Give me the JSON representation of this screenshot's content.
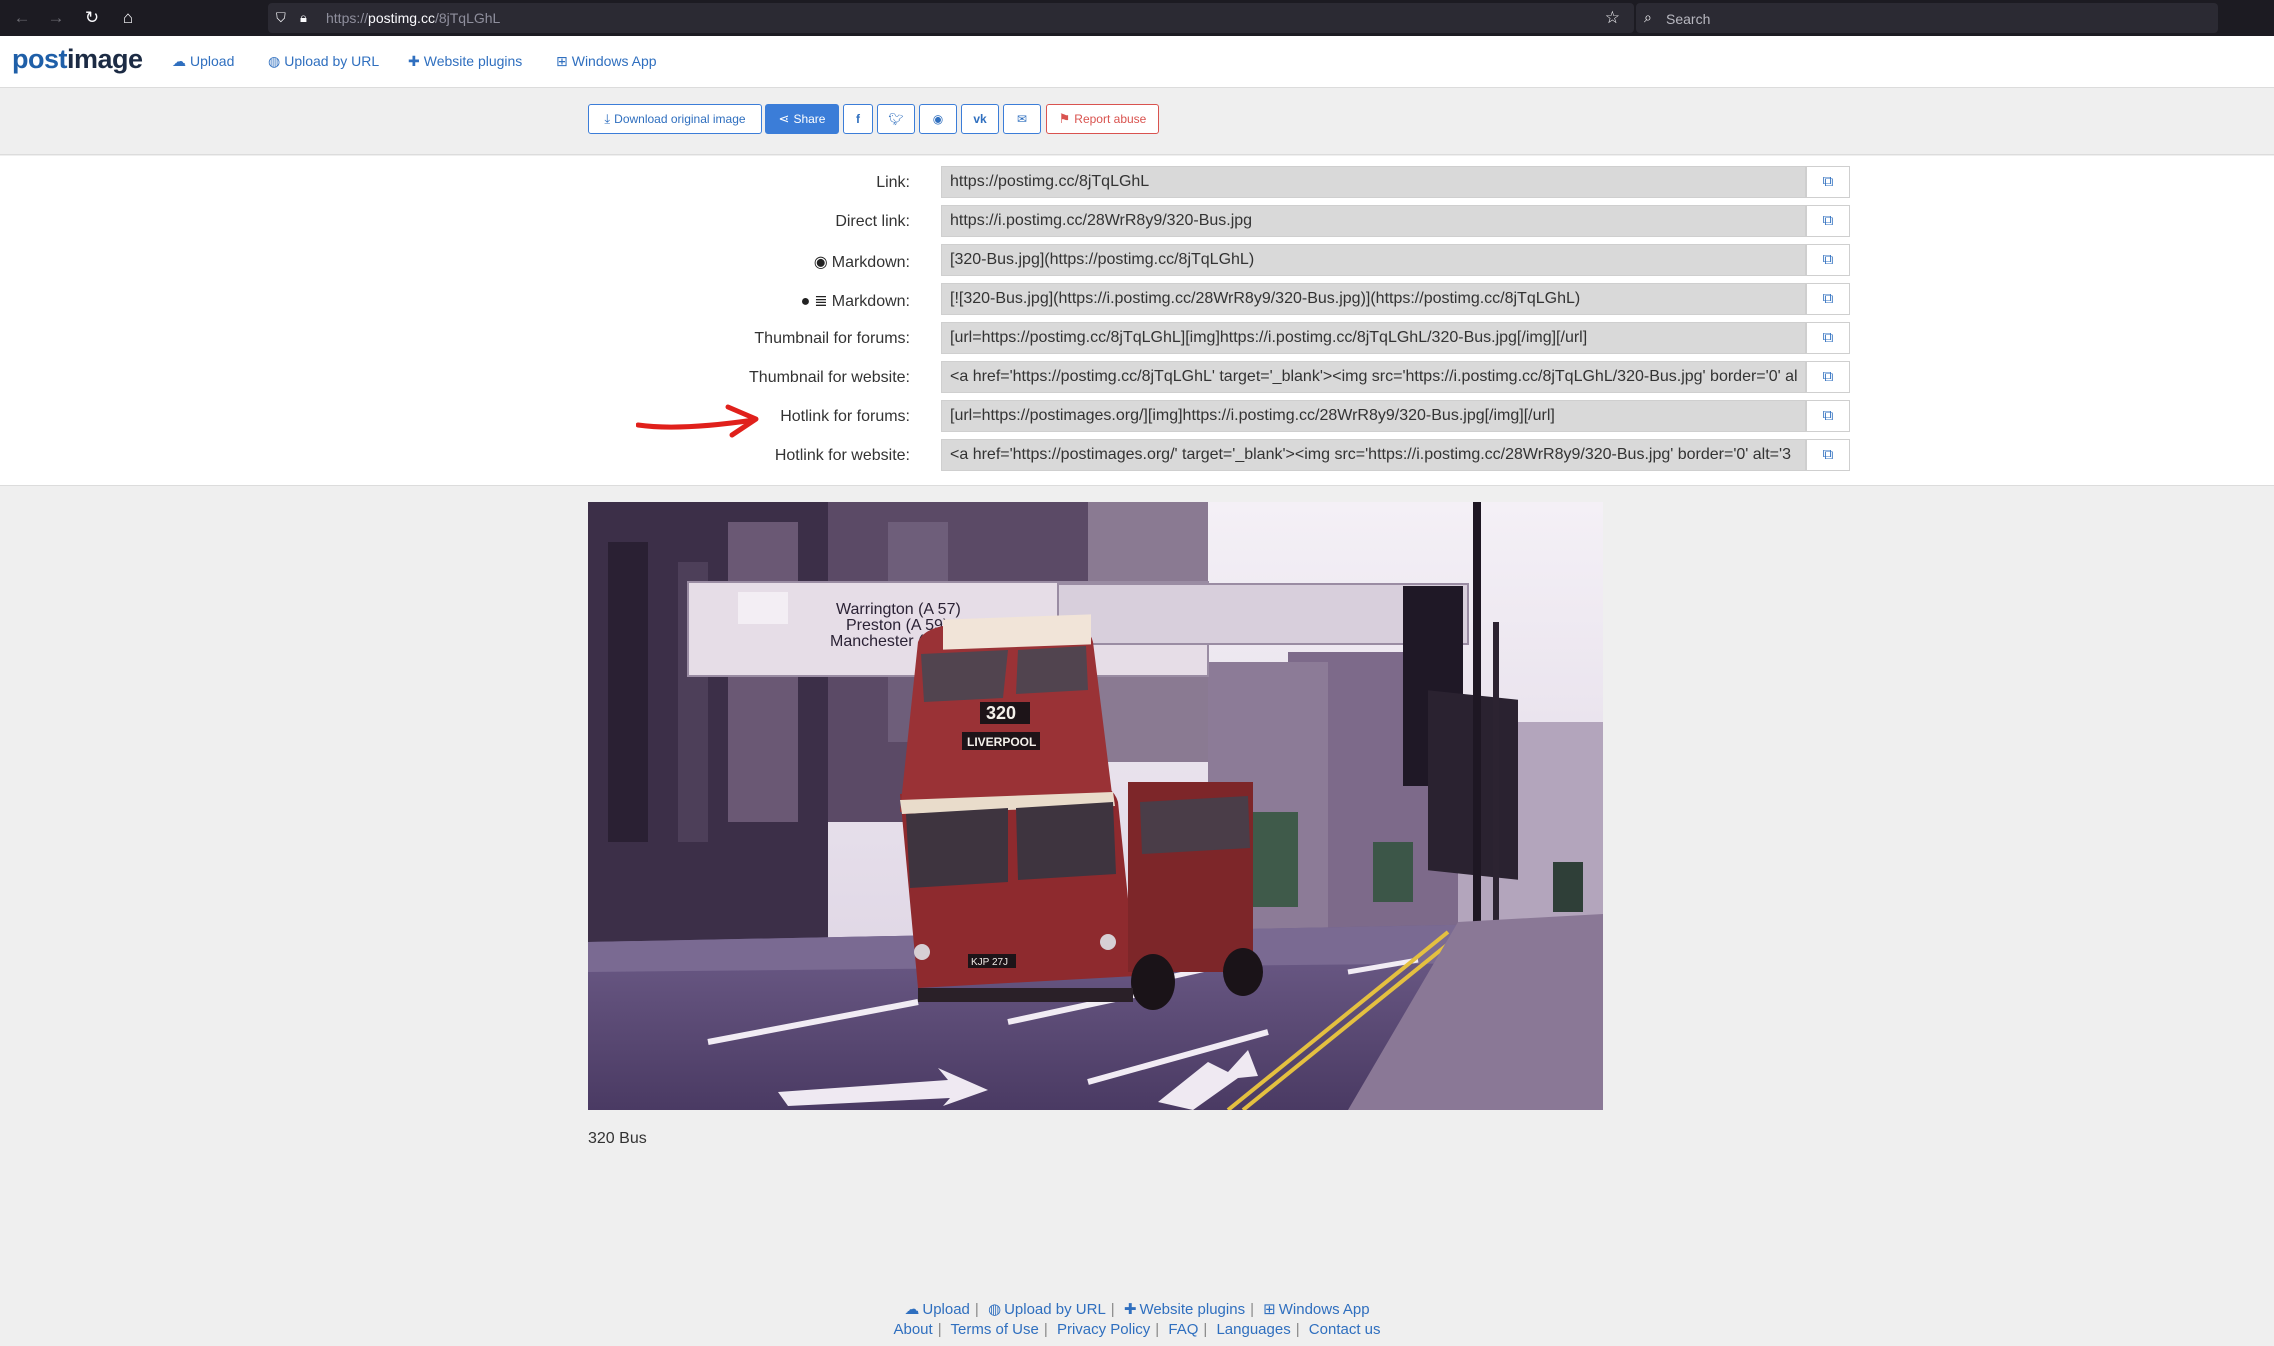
{
  "browser": {
    "back_icon": "arrow-left-icon",
    "forward_icon": "arrow-right-icon",
    "reload_icon": "reload-icon",
    "home_icon": "home-icon",
    "url_scheme": "https://",
    "url_host": "postimg.cc",
    "url_path": "/8jTqLGhL",
    "search_placeholder": "Search"
  },
  "header": {
    "logo_part1": "post",
    "logo_part2": "image",
    "menu": [
      {
        "label": "Upload",
        "icon": "cloud-upload-icon"
      },
      {
        "label": "Upload by URL",
        "icon": "globe-icon"
      },
      {
        "label": "Website plugins",
        "icon": "puzzle-icon"
      },
      {
        "label": "Windows App",
        "icon": "windows-icon"
      }
    ]
  },
  "toolbar": {
    "download_label": "Download original image",
    "share_label": "Share",
    "report_label": "Report abuse",
    "social": [
      "facebook-icon",
      "twitter-icon",
      "reddit-icon",
      "vk-icon",
      "email-icon"
    ]
  },
  "links": [
    {
      "label": "Link:",
      "value": "https://postimg.cc/8jTqLGhL"
    },
    {
      "label": "Direct link:",
      "value": "https://i.postimg.cc/28WrR8y9/320-Bus.jpg"
    },
    {
      "label": "Markdown:",
      "value": "[320-Bus.jpg](https://postimg.cc/8jTqLGhL)",
      "icons": [
        "reddit-icon"
      ]
    },
    {
      "label": "Markdown:",
      "value": "[![320-Bus.jpg](https://i.postimg.cc/28WrR8y9/320-Bus.jpg)](https://postimg.cc/8jTqLGhL)",
      "icons": [
        "github-icon",
        "stackoverflow-icon"
      ]
    },
    {
      "label": "Thumbnail for forums:",
      "value": "[url=https://postimg.cc/8jTqLGhL][img]https://i.postimg.cc/8jTqLGhL/320-Bus.jpg[/img][/url]"
    },
    {
      "label": "Thumbnail for website:",
      "value": "<a href='https://postimg.cc/8jTqLGhL' target='_blank'><img src='https://i.postimg.cc/8jTqLGhL/320-Bus.jpg' border='0' al"
    },
    {
      "label": "Hotlink for forums:",
      "value": "[url=https://postimages.org/][img]https://i.postimg.cc/28WrR8y9/320-Bus.jpg[/img][/url]"
    },
    {
      "label": "Hotlink for website:",
      "value": "<a href='https://postimages.org/' target='_blank'><img src='https://i.postimg.cc/28WrR8y9/320-Bus.jpg' border='0' alt='3"
    }
  ],
  "image": {
    "sign_line1": "Warrington (A 57)",
    "sign_line2": "Preston (A 59)",
    "sign_line3": "Manchester (A 5",
    "bus_number": "320",
    "bus_destination": "LIVERPOOL",
    "bus_plate": "KJP 27J",
    "caption": "320 Bus"
  },
  "footer": {
    "row1": [
      {
        "label": "Upload",
        "icon": "cloud-upload-icon"
      },
      {
        "label": "Upload by URL",
        "icon": "globe-icon"
      },
      {
        "label": "Website plugins",
        "icon": "puzzle-icon"
      },
      {
        "label": "Windows App",
        "icon": "windows-icon"
      }
    ],
    "row2": [
      "About",
      "Terms of Use",
      "Privacy Policy",
      "FAQ",
      "Languages",
      "Contact us"
    ]
  },
  "colors": {
    "accent": "#3b7dd8",
    "link": "#2f6fbf",
    "report": "#d9534f",
    "annotation_arrow": "#e0201b"
  }
}
